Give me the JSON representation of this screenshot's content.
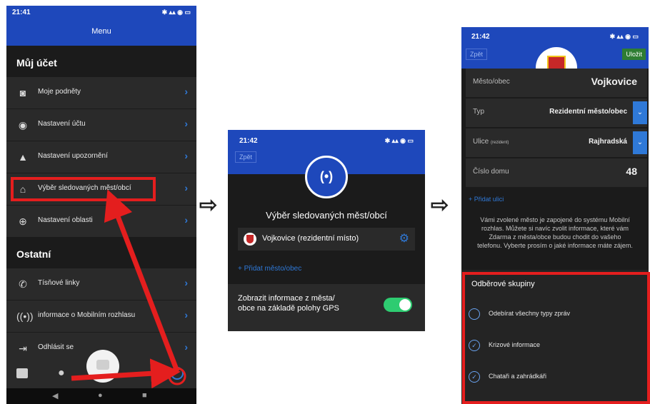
{
  "phone1": {
    "status_time": "21:41",
    "title": "Menu",
    "section_account": "Můj účet",
    "account_items": [
      {
        "label": "Moje podněty",
        "icon": "camera-icon"
      },
      {
        "label": "Nastavení účtu",
        "icon": "user-icon"
      },
      {
        "label": "Nastavení upozornění",
        "icon": "bell-icon"
      },
      {
        "label": "Výběr sledovaných měst/obcí",
        "icon": "home-icon"
      },
      {
        "label": "Nastavení oblasti",
        "icon": "globe-icon"
      }
    ],
    "section_other": "Ostatní",
    "other_items": [
      {
        "label": "Tísňové linky",
        "icon": "phone-icon"
      },
      {
        "label": "informace o Mobilním rozhlasu",
        "icon": "broadcast-icon"
      },
      {
        "label": "Odhlásit se",
        "icon": "logout-icon"
      }
    ]
  },
  "phone2": {
    "status_time": "21:42",
    "back": "Zpět",
    "heading": "Výběr sledovaných měst/obcí",
    "city": "Vojkovice (rezidentní místo)",
    "add_city": "Přidat město/obec",
    "gps_line1": "Zobrazit informace z města/",
    "gps_line2": "obce na základě polohy GPS"
  },
  "phone3": {
    "status_time": "21:42",
    "back": "Zpět",
    "save": "Uložit",
    "fields": [
      {
        "label": "Město/obec",
        "value": "Vojkovice"
      },
      {
        "label": "Typ",
        "value": "Rezidentní město/obec"
      },
      {
        "label": "Ulice",
        "label_small": "(rezident)",
        "value": "Rajhradská"
      },
      {
        "label": "Číslo domu",
        "value": "48"
      }
    ],
    "add_street": "Přidat ulici",
    "info_lines": [
      "Vámi zvolené město je zapojené do systému Mobilní",
      "rozhlas. Můžete si navíc zvolit informace, které vám",
      "Zdarma z města/obce budou chodit do vašeho",
      "telefonu. Vyberte prosím o jaké informace máte zájem."
    ],
    "groups_title": "Odběrové skupiny",
    "groups": [
      {
        "label": "Odebírat všechny typy zpráv",
        "checked": false
      },
      {
        "label": "Krizové informace",
        "checked": true
      },
      {
        "label": "Chataři a zahrádkáři",
        "checked": true
      }
    ]
  },
  "colors": {
    "brand_blue": "#1e48bb",
    "accent_blue": "#2f79d8",
    "save_green": "#2e7d32",
    "highlight_red": "#e41e1e",
    "toggle_green": "#2ecc71"
  }
}
